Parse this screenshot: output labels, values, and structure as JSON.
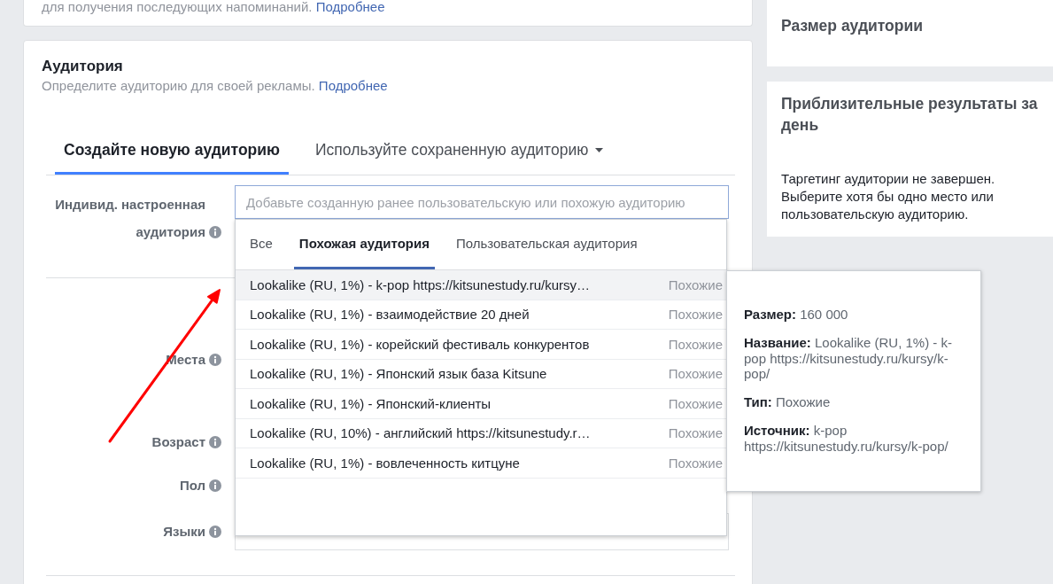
{
  "top_card": {
    "text": "для получения последующих напоминаний.",
    "link": "Подробнее"
  },
  "audience": {
    "title": "Аудитория",
    "subtitle": "Определите аудиторию для своей рекламы.",
    "link": "Подробнее",
    "tabs": [
      {
        "label": "Создайте новую аудиторию",
        "selected": true,
        "dropdown": false
      },
      {
        "label": "Используйте сохраненную аудиторию",
        "selected": false,
        "dropdown": true
      }
    ],
    "rows": [
      {
        "label": "Индивид. настроенная аудитория",
        "kind": "audience_input",
        "placeholder": "Добавьте созданную ранее пользовательскую или похожую аудиторию"
      },
      {
        "label": "Места",
        "kind": "label_only"
      },
      {
        "label": "Возраст",
        "kind": "label_only"
      },
      {
        "label": "Пол",
        "kind": "label_only"
      },
      {
        "label": "Языки",
        "kind": "empty_field"
      }
    ]
  },
  "audience_dropdown": {
    "tabs": [
      {
        "label": "Все",
        "selected": false
      },
      {
        "label": "Похожая аудитория",
        "selected": true
      },
      {
        "label": "Пользовательская аудитория",
        "selected": false
      }
    ],
    "items": [
      {
        "name": "Lookalike (RU, 1%) - k-pop https://kitsunestudy.ru/kursy…",
        "type": "Похожие",
        "selected": true
      },
      {
        "name": "Lookalike (RU, 1%) - взаимодействие 20 дней",
        "type": "Похожие",
        "selected": false
      },
      {
        "name": "Lookalike (RU, 1%) - корейский фестиваль конкурентов",
        "type": "Похожие",
        "selected": false
      },
      {
        "name": "Lookalike (RU, 1%) - Японский язык база Kitsune",
        "type": "Похожие",
        "selected": false
      },
      {
        "name": "Lookalike (RU, 1%) - Японский-клиенты",
        "type": "Похожие",
        "selected": false
      },
      {
        "name": "Lookalike (RU, 10%) - английский https://kitsunestudy.r…",
        "type": "Похожие",
        "selected": false
      },
      {
        "name": "Lookalike (RU, 1%) - вовлеченность китцуне",
        "type": "Похожие",
        "selected": false
      }
    ]
  },
  "tooltip": {
    "lines": [
      "**Размер:** 160 000",
      "**Название:** Lookalike (RU, 1%) - k-pop https://kitsunestudy.ru/kursy/k-pop/",
      "**Тип:** Похожие",
      "**Источник:** k-pop https://kitsunestudy.ru/kursy/k-pop/"
    ]
  },
  "sidebar": {
    "cards": [
      {
        "title": "Размер аудитории"
      },
      {
        "title": "Приблизительные результаты за день",
        "text": "Таргетинг аудитории не завершен. Выберите хотя бы одно место или пользовательскую аудиторию."
      }
    ]
  }
}
